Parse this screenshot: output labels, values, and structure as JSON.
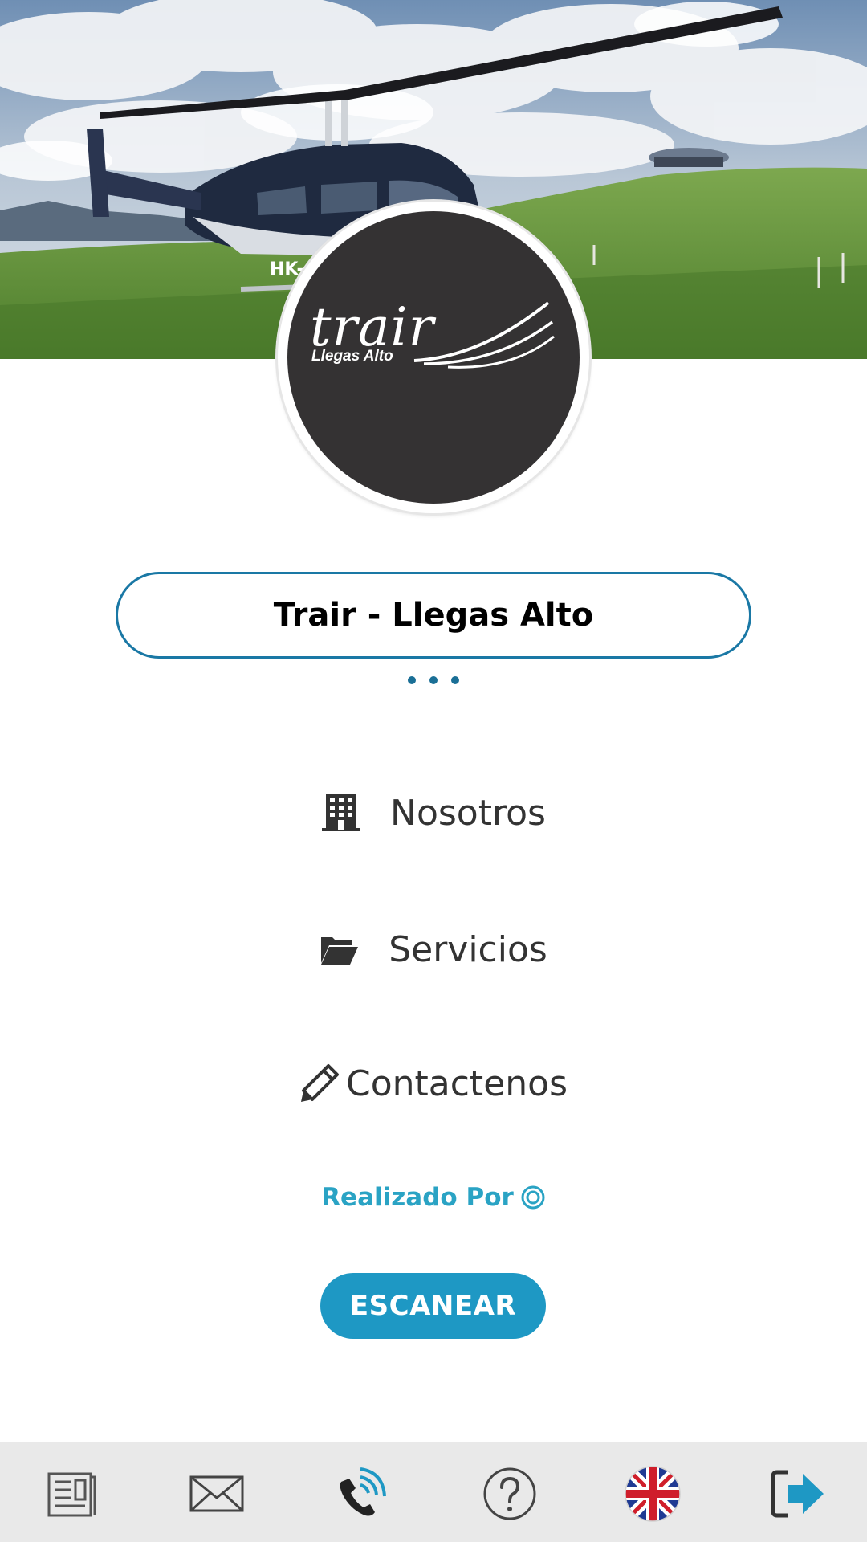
{
  "header": {
    "logo": {
      "wordmark": "trair",
      "tagline": "Llegas Alto"
    }
  },
  "profile": {
    "name": "Trair - Llegas Alto"
  },
  "menu": {
    "items": [
      {
        "label": "Nosotros",
        "icon": "building-icon"
      },
      {
        "label": "Servicios",
        "icon": "folder-open-icon"
      },
      {
        "label": "Contactenos",
        "icon": "pencil-icon"
      }
    ]
  },
  "footer": {
    "credit_label": "Realizado Por",
    "credit_icon": "target-icon",
    "scan_button": "ESCANEAR"
  },
  "bottom_nav": {
    "items": [
      {
        "icon": "news-icon"
      },
      {
        "icon": "mail-icon"
      },
      {
        "icon": "phone-call-icon"
      },
      {
        "icon": "help-icon"
      },
      {
        "icon": "uk-flag-icon"
      },
      {
        "icon": "logout-icon"
      }
    ]
  },
  "colors": {
    "accent": "#1e98c4",
    "pill_border": "#1a78a5",
    "credit_text": "#2aa3c4",
    "logo_bg": "#343233",
    "bottom_bar_bg": "#e9e9e9"
  }
}
